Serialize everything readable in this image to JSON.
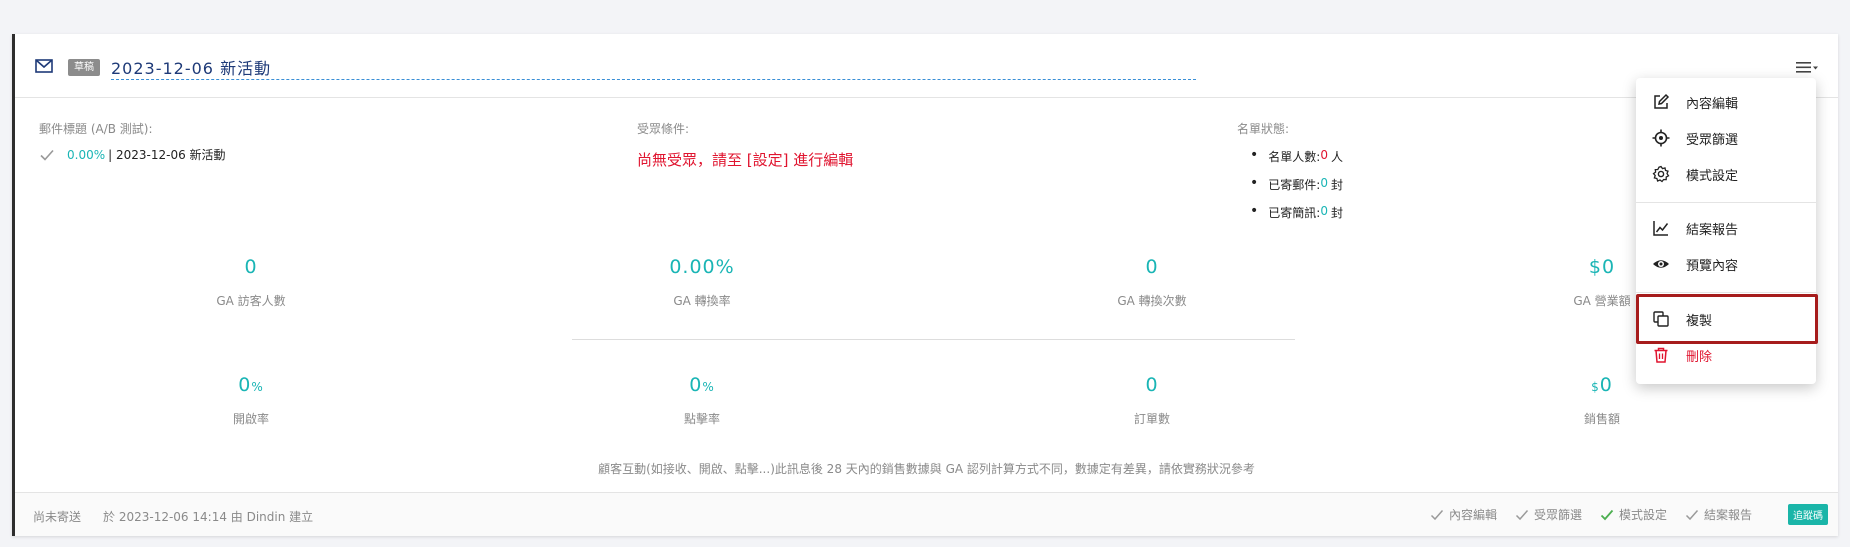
{
  "campaign": {
    "draft_label": "草稿",
    "title": "2023-12-06 新活動"
  },
  "sections": {
    "subject_label": "郵件標題 (A/B 測試):",
    "subject_rate": "0.00%",
    "subject_text": "| 2023-12-06 新活動",
    "audience_label": "受眾條件:",
    "audience_warning": "尚無受眾，請至 [設定] 進行編輯",
    "list_status_label": "名單狀態:",
    "list_status": [
      {
        "label": "名單人數:",
        "value": "0",
        "unit": "人"
      },
      {
        "label": "已寄郵件:",
        "value": "0",
        "unit": "封"
      },
      {
        "label": "已寄簡訊:",
        "value": "0",
        "unit": "封"
      }
    ]
  },
  "metrics_top": [
    {
      "value": "0",
      "label": "GA 訪客人數"
    },
    {
      "value": "0.00%",
      "label": "GA 轉換率"
    },
    {
      "value": "0",
      "label": "GA 轉換次數"
    },
    {
      "value": "$0",
      "label": "GA 營業額"
    }
  ],
  "metrics_bottom": [
    {
      "value": "0",
      "suffix": "%",
      "label": "開啟率"
    },
    {
      "value": "0",
      "suffix": "%",
      "label": "點擊率"
    },
    {
      "value": "0",
      "label": "訂單數"
    },
    {
      "prefix": "$",
      "value": "0",
      "label": "銷售額"
    }
  ],
  "note": "顧客互動(如接收、開啟、點擊...)此訊息後 28 天內的銷售數據與 GA 認列計算方式不同，數據定有差異，請依實務狀況參考",
  "footer": {
    "send_status": "尚未寄送",
    "created_info": "於 2023-12-06 14:14 由 Dindin 建立",
    "steps": [
      {
        "label": "內容編輯",
        "done": false
      },
      {
        "label": "受眾篩選",
        "done": false
      },
      {
        "label": "模式設定",
        "done": true
      },
      {
        "label": "結案報告",
        "done": false
      }
    ],
    "tracking_badge": "追蹤碼"
  },
  "dropdown_menu": {
    "items": [
      {
        "label": "內容編輯",
        "icon": "edit-icon"
      },
      {
        "label": "受眾篩選",
        "icon": "crosshair-icon"
      },
      {
        "label": "模式設定",
        "icon": "gear-icon"
      },
      {
        "label": "結案報告",
        "icon": "chart-icon"
      },
      {
        "label": "預覽內容",
        "icon": "eye-icon"
      },
      {
        "label": "複製",
        "icon": "copy-icon"
      },
      {
        "label": "刪除",
        "icon": "trash-icon"
      }
    ]
  },
  "colors": {
    "accent_teal": "#1ab5b5",
    "danger_red": "#e0142f",
    "title_blue": "#1e3a78",
    "highlight_border": "#a61c1c",
    "done_green": "#4caf50"
  }
}
